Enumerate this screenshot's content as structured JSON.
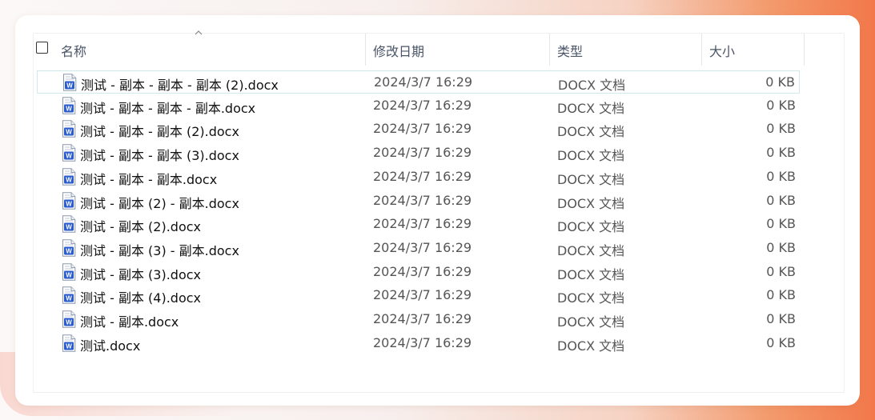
{
  "columns": {
    "name": "名称",
    "date": "修改日期",
    "type": "类型",
    "size": "大小"
  },
  "icons": {
    "file": "word-document-icon",
    "sort": "sort-ascending-icon"
  },
  "colors": {
    "word_blue": "#2b5cce",
    "selection_border": "#cfe8ea"
  },
  "files": [
    {
      "name": "测试 - 副本 - 副本 - 副本 (2).docx",
      "date": "2024/3/7 16:29",
      "type": "DOCX 文档",
      "size": "0 KB"
    },
    {
      "name": "测试 - 副本 - 副本 - 副本.docx",
      "date": "2024/3/7 16:29",
      "type": "DOCX 文档",
      "size": "0 KB"
    },
    {
      "name": "测试 - 副本 - 副本 (2).docx",
      "date": "2024/3/7 16:29",
      "type": "DOCX 文档",
      "size": "0 KB"
    },
    {
      "name": "测试 - 副本 - 副本 (3).docx",
      "date": "2024/3/7 16:29",
      "type": "DOCX 文档",
      "size": "0 KB"
    },
    {
      "name": "测试 - 副本 - 副本.docx",
      "date": "2024/3/7 16:29",
      "type": "DOCX 文档",
      "size": "0 KB"
    },
    {
      "name": "测试 - 副本 (2) - 副本.docx",
      "date": "2024/3/7 16:29",
      "type": "DOCX 文档",
      "size": "0 KB"
    },
    {
      "name": "测试 - 副本 (2).docx",
      "date": "2024/3/7 16:29",
      "type": "DOCX 文档",
      "size": "0 KB"
    },
    {
      "name": "测试 - 副本 (3) - 副本.docx",
      "date": "2024/3/7 16:29",
      "type": "DOCX 文档",
      "size": "0 KB"
    },
    {
      "name": "测试 - 副本 (3).docx",
      "date": "2024/3/7 16:29",
      "type": "DOCX 文档",
      "size": "0 KB"
    },
    {
      "name": "测试 - 副本 (4).docx",
      "date": "2024/3/7 16:29",
      "type": "DOCX 文档",
      "size": "0 KB"
    },
    {
      "name": "测试 - 副本.docx",
      "date": "2024/3/7 16:29",
      "type": "DOCX 文档",
      "size": "0 KB"
    },
    {
      "name": "测试.docx",
      "date": "2024/3/7 16:29",
      "type": "DOCX 文档",
      "size": "0 KB"
    }
  ]
}
